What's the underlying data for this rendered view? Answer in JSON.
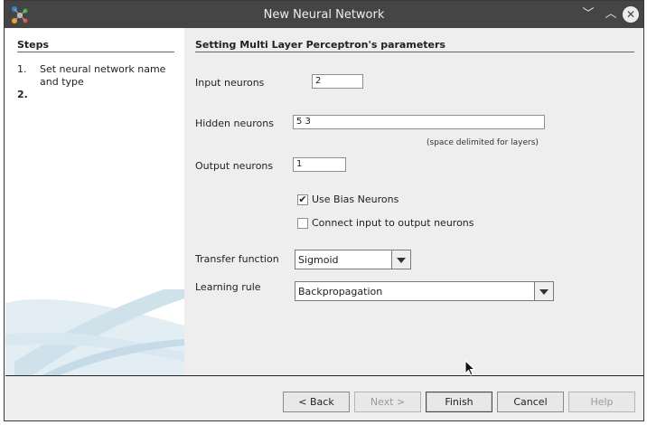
{
  "window": {
    "title": "New Neural Network"
  },
  "steps": {
    "heading": "Steps",
    "items": [
      {
        "number": "1.",
        "label": "Set neural network name and type"
      },
      {
        "number": "2.",
        "label": ""
      }
    ]
  },
  "form": {
    "heading": "Setting Multi Layer Perceptron's parameters",
    "input_neurons": {
      "label": "Input neurons",
      "value": "2"
    },
    "hidden_neurons": {
      "label": "Hidden neurons",
      "value": "5 3",
      "hint": "(space delimited for layers)"
    },
    "output_neurons": {
      "label": "Output neurons",
      "value": "1"
    },
    "use_bias": {
      "label": "Use Bias Neurons",
      "checked": true
    },
    "connect_io": {
      "label": "Connect input to output neurons",
      "checked": false
    },
    "transfer_function": {
      "label": "Transfer function",
      "value": "Sigmoid"
    },
    "learning_rule": {
      "label": "Learning rule",
      "value": "Backpropagation"
    }
  },
  "buttons": {
    "back": "< Back",
    "next": "Next >",
    "finish": "Finish",
    "cancel": "Cancel",
    "help": "Help"
  }
}
